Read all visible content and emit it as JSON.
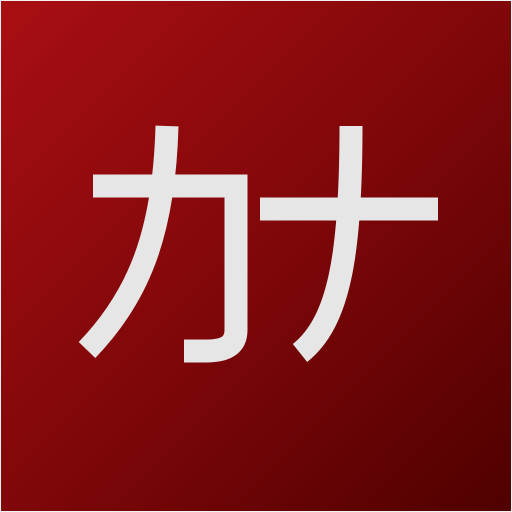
{
  "app_icon": {
    "name": "katakana-app-icon",
    "text": "カナ",
    "colors": {
      "gradient_start": "#a90f13",
      "gradient_mid": "#7e0709",
      "gradient_end": "#4f0000",
      "glyph": "#e6e6e6",
      "border": "#f2f2f2"
    }
  }
}
